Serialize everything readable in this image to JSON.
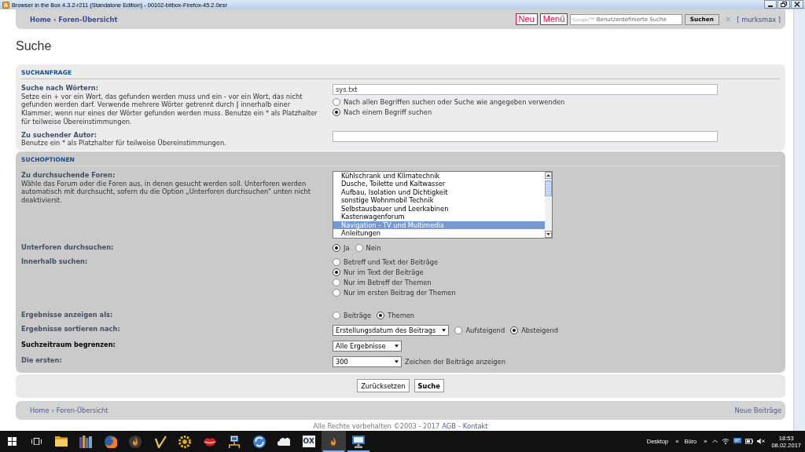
{
  "window": {
    "title": "Browser in the Box 4.3.2-r211 (Standalone Edition) - 00102-bitbox-Firefox-45.2.0esr"
  },
  "top_nav": {
    "breadcrumbs": [
      "Home",
      "Foren-Übersicht"
    ],
    "separator": "‹",
    "buttons": [
      "Neu",
      "Menü"
    ],
    "search": {
      "brand": "Google™",
      "placeholder": "Benutzerdefinierte Suche",
      "button": "Suchen",
      "clear": "×"
    },
    "user": "[ murksmax ]"
  },
  "heading": "Suche",
  "sections": [
    {
      "title": "SUCHANFRAGE",
      "groups": [
        [
          {
            "label": "Suche nach Wörtern:",
            "emphasized": false,
            "description": "Setze ein + vor ein Wort, das gefunden werden muss und ein - vor ein Wort, das nicht gefunden werden darf. Verwende mehrere Wörter getrennt durch **|** innerhalb einer Klammer, wenn nur eines der Wörter gefunden werden muss. Benutze ein * als Platzhalter für teilweise Übereinstimmungen.",
            "inline": false,
            "controls": [
              {
                "kind": "input",
                "value": "sys.txt"
              },
              {
                "kind": "radio",
                "label": "Nach allen Begriffen suchen oder Suche wie angegeben verwenden",
                "selected": false
              },
              {
                "kind": "radio",
                "label": "Nach einem Begriff suchen",
                "selected": true
              }
            ]
          },
          {
            "label": "Zu suchender Autor:",
            "emphasized": false,
            "description": "Benutze ein * als Platzhalter für teilweise Übereinstimmungen.",
            "inline": false,
            "controls": [
              {
                "kind": "input"
              }
            ]
          }
        ]
      ]
    },
    {
      "title": "SUCHOPTIONEN",
      "groups": [
        [
          {
            "label": "Zu durchsuchende Foren:",
            "emphasized": false,
            "description": "Wähle das Forum oder die Foren aus, in denen gesucht werden soll. Unterforen werden automatisch mit durchsucht, sofern du die Option „Unterforen durchsuchen“ unten nicht deaktivierst.",
            "inline": false,
            "controls": [
              {
                "kind": "listbox",
                "options": [
                  {
                    "label": "Kühlschrank und Klimatechnik",
                    "selected": false
                  },
                  {
                    "label": "Dusche, Toilette und Kaltwasser",
                    "selected": false
                  },
                  {
                    "label": "Aufbau, Isolation und Dichtigkeit",
                    "selected": false
                  },
                  {
                    "label": "sonstige Wohnmobil Technik",
                    "selected": false
                  },
                  {
                    "label": "Selbstausbauer und Leerkabinen",
                    "selected": false
                  },
                  {
                    "label": "Kastenwagenforum",
                    "selected": false
                  },
                  {
                    "label": "Navigation - TV und Multimedia",
                    "selected": true
                  },
                  {
                    "label": "Anleitungen",
                    "selected": false
                  }
                ]
              }
            ]
          },
          {
            "label": "Unterforen durchsuchen:",
            "emphasized": false,
            "inline": true,
            "controls": [
              {
                "kind": "radio",
                "label": "Ja",
                "selected": true
              },
              {
                "kind": "radio",
                "label": "Nein",
                "selected": false
              }
            ]
          },
          {
            "label": "Innerhalb suchen:",
            "emphasized": false,
            "inline": false,
            "controls": [
              {
                "kind": "radio",
                "label": "Betreff und Text der Beiträge",
                "selected": false
              },
              {
                "kind": "radio",
                "label": "Nur im Text der Beiträge",
                "selected": true
              },
              {
                "kind": "radio",
                "label": "Nur im Betreff der Themen",
                "selected": false
              },
              {
                "kind": "radio",
                "label": "Nur im ersten Beitrag der Themen",
                "selected": false
              }
            ]
          }
        ],
        [
          {
            "label": "Ergebnisse anzeigen als:",
            "emphasized": false,
            "inline": true,
            "controls": [
              {
                "kind": "radio",
                "label": "Beiträge",
                "selected": false
              },
              {
                "kind": "radio",
                "label": "Themen",
                "selected": true
              }
            ]
          },
          {
            "label": "Ergebnisse sortieren nach:",
            "emphasized": false,
            "inline": true,
            "controls": [
              {
                "kind": "select",
                "value": "Erstellungsdatum des Beitrags"
              },
              {
                "kind": "radio",
                "label": "Aufsteigend",
                "selected": false
              },
              {
                "kind": "radio",
                "label": "Absteigend",
                "selected": true
              }
            ]
          },
          {
            "label": "Suchzeitraum begrenzen:",
            "emphasized": true,
            "inline": true,
            "controls": [
              {
                "kind": "select",
                "value": "Alle Ergebnisse"
              }
            ]
          },
          {
            "label": "Die ersten:",
            "emphasized": false,
            "inline": true,
            "controls": [
              {
                "kind": "select",
                "value": "300"
              },
              {
                "kind": "note",
                "text": "Zeichen der Beiträge anzeigen"
              }
            ]
          }
        ]
      ]
    }
  ],
  "actions": [
    {
      "kind": "reset",
      "label": "Zurücksetzen"
    },
    {
      "kind": "submit",
      "label": "Suche"
    }
  ],
  "bottom_nav": {
    "breadcrumbs": [
      "Home",
      "Foren-Übersicht"
    ],
    "separator": "‹",
    "link": "Neue Beiträge"
  },
  "footer": {
    "text": "Alle Rechte vorbehalten ©2003 - 2017",
    "links": [
      "AGB",
      "Kontakt"
    ],
    "separator": "-"
  },
  "taskbar": {
    "apps": [
      {
        "kind": "folder",
        "selected": false,
        "running": false
      },
      {
        "kind": "books",
        "selected": false,
        "running": false
      },
      {
        "kind": "globe",
        "selected": false,
        "running": false
      },
      {
        "kind": "flame",
        "selected": false,
        "running": false
      },
      {
        "kind": "check",
        "selected": false,
        "running": false
      },
      {
        "kind": "sun",
        "selected": false,
        "running": false
      },
      {
        "kind": "lips",
        "selected": false,
        "running": false
      },
      {
        "kind": "network",
        "selected": false,
        "running": false
      },
      {
        "kind": "sync",
        "selected": false,
        "running": false
      },
      {
        "kind": "cloud",
        "selected": false,
        "running": false
      },
      {
        "kind": "logo",
        "label": "OX",
        "selected": false,
        "running": false
      },
      {
        "kind": "flame",
        "selected": true,
        "running": true
      },
      {
        "kind": "monitor",
        "selected": false,
        "running": true
      }
    ],
    "toolbars": [
      "Desktop",
      "Büro"
    ],
    "toolbar_chevron": "»",
    "time": "18:53",
    "date": "08.02.2017"
  }
}
